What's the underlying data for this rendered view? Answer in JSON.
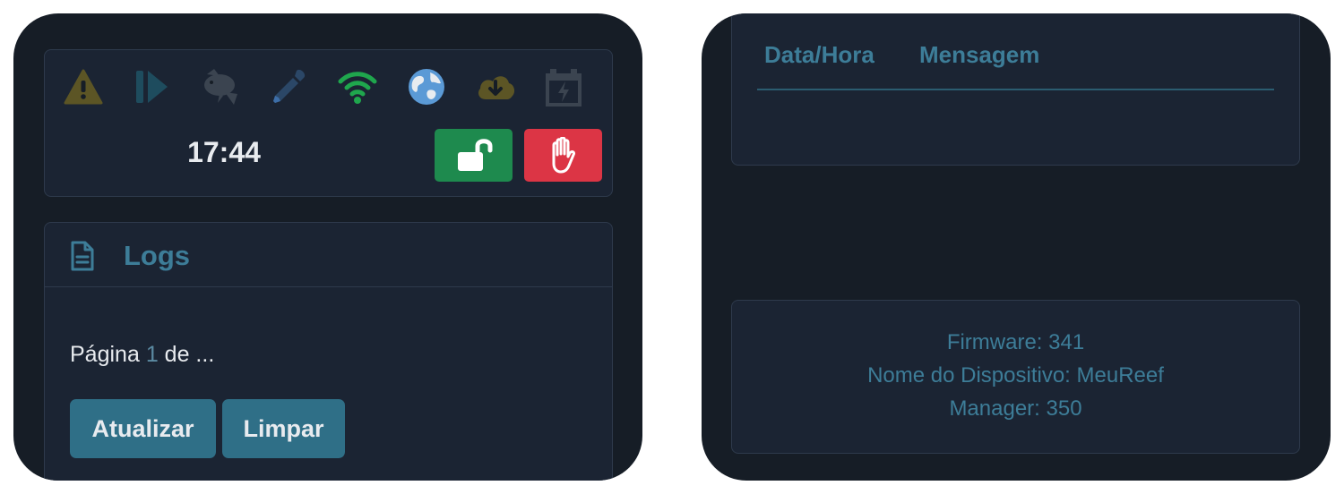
{
  "status_bar": {
    "icons": [
      {
        "name": "warning-icon",
        "color": "#5c5525"
      },
      {
        "name": "play-step-icon",
        "color": "#1e4c5e"
      },
      {
        "name": "fish-icon",
        "color": "#3b4450"
      },
      {
        "name": "dropper-icon",
        "color": "#2b4767"
      },
      {
        "name": "wifi-icon",
        "color": "#1fa64d"
      },
      {
        "name": "globe-icon",
        "color": "#5b9ad6"
      },
      {
        "name": "cloud-download-icon",
        "color": "#5c5525"
      },
      {
        "name": "battery-charging-icon",
        "color": "#3b4450"
      }
    ],
    "time": "17:44",
    "unlock_color": "#1e8a4e",
    "stop_color": "#dc3545"
  },
  "logs": {
    "title": "Logs",
    "page_prefix": "Página",
    "page_current": "1",
    "page_suffix": "de ...",
    "refresh_label": "Atualizar",
    "clear_label": "Limpar"
  },
  "log_table": {
    "columns": [
      "Data/Hora",
      "Mensagem"
    ],
    "rows": []
  },
  "device_info": {
    "firmware": "Firmware: 341",
    "device_name": "Nome do Dispositivo: MeuReef",
    "manager": "Manager: 350"
  },
  "colors": {
    "accent": "#3d7d98",
    "button": "#2f6f87",
    "background": "#161d26",
    "card": "#1b2433"
  }
}
